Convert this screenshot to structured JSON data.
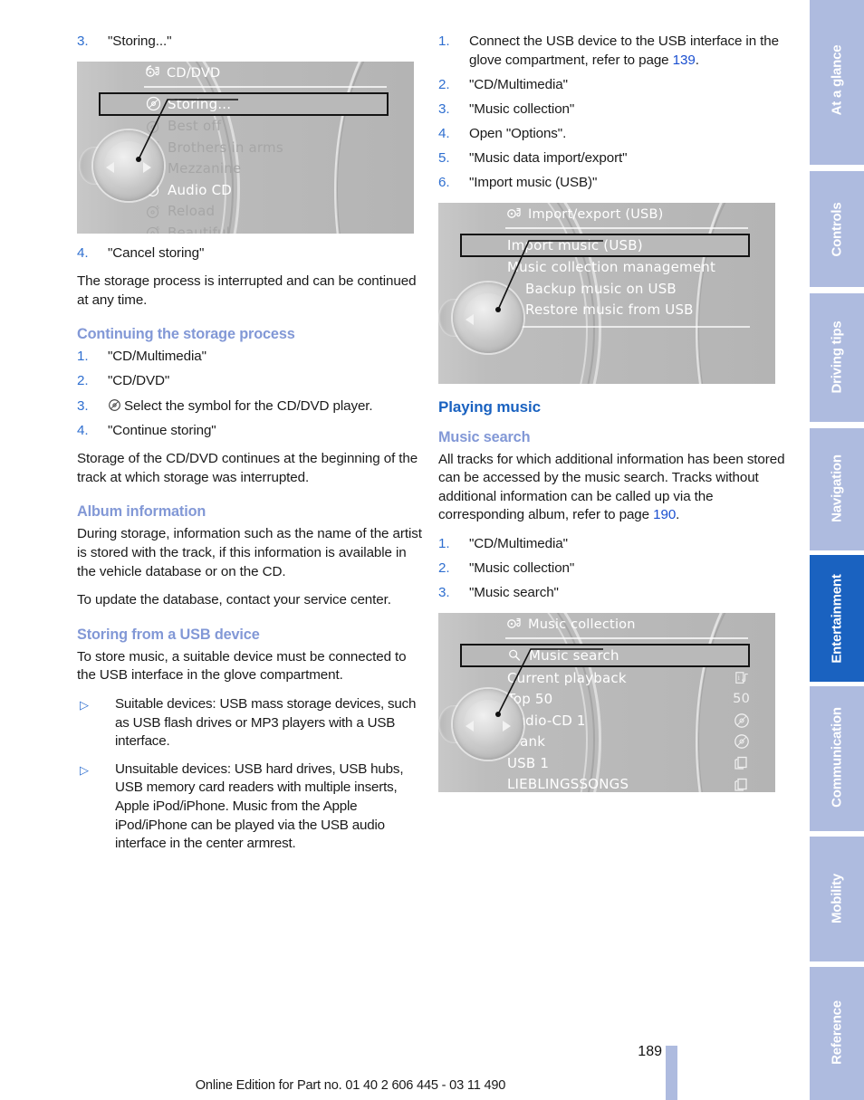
{
  "meta": {
    "page_number": "189",
    "footer_line": "Online Edition for Part no. 01 40 2 606 445 - 03 11 490",
    "accent_blue": "#1a62c0",
    "sub_heading_blue": "#8298d6",
    "link_blue": "#1a4fd0",
    "tab_blue": "#aebbdf"
  },
  "left_column": {
    "step3": {
      "num": "3.",
      "text": "\"Storing...\""
    },
    "screen_cd_dvd": {
      "header_icon": "cd-multimedia-icon",
      "title": "CD/DVD",
      "rows": [
        {
          "label": "Storing...",
          "icon": "disc-icon",
          "state": "selected"
        },
        {
          "label": "Best off",
          "icon": "disc-1-icon",
          "state": "dim"
        },
        {
          "label": "Brothers in arms",
          "icon": "disc-2-icon",
          "state": "dim"
        },
        {
          "label": "Mezzanine",
          "icon": "disc-3-icon",
          "state": "dim"
        },
        {
          "label": "Audio CD",
          "icon": "disc-4-icon",
          "state": "white"
        },
        {
          "label": "Reload",
          "icon": "disc-5-icon",
          "state": "dim"
        },
        {
          "label": "Beautiful",
          "icon": "disc-6-icon",
          "state": "dim"
        }
      ]
    },
    "step4": {
      "num": "4.",
      "text": "\"Cancel storing\""
    },
    "para_interrupted": "The storage process is interrupted and can be continued at any time.",
    "heading_continuing": "Continuing the storage process",
    "continuing_steps": [
      {
        "num": "1.",
        "text": "\"CD/Multimedia\""
      },
      {
        "num": "2.",
        "text": "\"CD/DVD\""
      },
      {
        "num": "3.",
        "text": "Select the symbol for the CD/DVD player.",
        "icon": "disc-icon"
      },
      {
        "num": "4.",
        "text": "\"Continue storing\""
      }
    ],
    "para_continues": "Storage of the CD/DVD continues at the beginning of the track at which storage was interrupted.",
    "heading_album_information": "Album information",
    "para_album_1": "During storage, information such as the name of the artist is stored with the track, if this information is available in the vehicle database or on the CD.",
    "para_album_2": "To update the database, contact your service center.",
    "heading_storing_usb": "Storing from a USB device",
    "para_usb_intro": "To store music, a suitable device must be connected to the USB interface in the glove compartment.",
    "bullets": [
      {
        "marker": "▷",
        "text": "Suitable devices: USB mass storage devices, such as USB flash drives or MP3 players with a USB interface."
      },
      {
        "marker": "▷",
        "text": "Unsuitable devices: USB hard drives, USB hubs, USB memory card readers with multiple inserts, Apple iPod/iPhone. Music from the Apple iPod/iPhone can be played via the USB audio interface in the center armrest."
      }
    ]
  },
  "right_column": {
    "usb_steps": [
      {
        "num": "1.",
        "text_before": "Connect the USB device to the USB interface in the glove compartment, refer to page ",
        "link": "139",
        "text_after": "."
      },
      {
        "num": "2.",
        "text": "\"CD/Multimedia\""
      },
      {
        "num": "3.",
        "text": "\"Music collection\""
      },
      {
        "num": "4.",
        "text": "Open \"Options\"."
      },
      {
        "num": "5.",
        "text": "\"Music data import/export\""
      },
      {
        "num": "6.",
        "text": "\"Import music (USB)\""
      }
    ],
    "screen_import_export": {
      "header_icon": "cd-multimedia-icon",
      "title": "Import/export (USB)",
      "rows": [
        {
          "label": "Import music (USB)",
          "state": "selected"
        },
        {
          "label": "Music collection management",
          "state": "normal"
        },
        {
          "label": "Backup music on USB",
          "state": "normal",
          "indent": true
        },
        {
          "label": "Restore music from USB",
          "state": "normal",
          "indent": true
        }
      ]
    },
    "heading_playing_music": "Playing music",
    "heading_music_search": "Music search",
    "para_music_search_before": "All tracks for which additional information has been stored can be accessed by the music search. Tracks without additional information can be called up via the corresponding album, refer to page ",
    "para_music_search_link": "190",
    "para_music_search_after": ".",
    "search_steps": [
      {
        "num": "1.",
        "text": "\"CD/Multimedia\""
      },
      {
        "num": "2.",
        "text": "\"Music collection\""
      },
      {
        "num": "3.",
        "text": "\"Music search\""
      }
    ],
    "screen_music_collection": {
      "header_icon": "cd-multimedia-icon",
      "title": "Music collection",
      "rows": [
        {
          "label": "Music search",
          "left_icon": "magnifier-icon",
          "right": "",
          "state": "selected"
        },
        {
          "label": "Current playback",
          "right_icon": "info-note-icon",
          "state": "normal"
        },
        {
          "label": "Top 50",
          "right": "50",
          "state": "normal"
        },
        {
          "label": "Audio-CD 1",
          "right_icon": "disc-icon",
          "state": "normal"
        },
        {
          "label": "Frank",
          "right_icon": "disc-icon",
          "state": "normal",
          "checked": true
        },
        {
          "label": "USB 1",
          "right_icon": "folders-icon",
          "state": "normal"
        },
        {
          "label": "LIEBLINGSSONGS",
          "right_icon": "folders-icon",
          "state": "normal"
        }
      ]
    }
  },
  "rail_tabs": [
    {
      "label": "At a glance",
      "active": false
    },
    {
      "label": "Controls",
      "active": false
    },
    {
      "label": "Driving tips",
      "active": false
    },
    {
      "label": "Navigation",
      "active": false
    },
    {
      "label": "Entertainment",
      "active": true
    },
    {
      "label": "Communication",
      "active": false
    },
    {
      "label": "Mobility",
      "active": false
    },
    {
      "label": "Reference",
      "active": false
    }
  ]
}
